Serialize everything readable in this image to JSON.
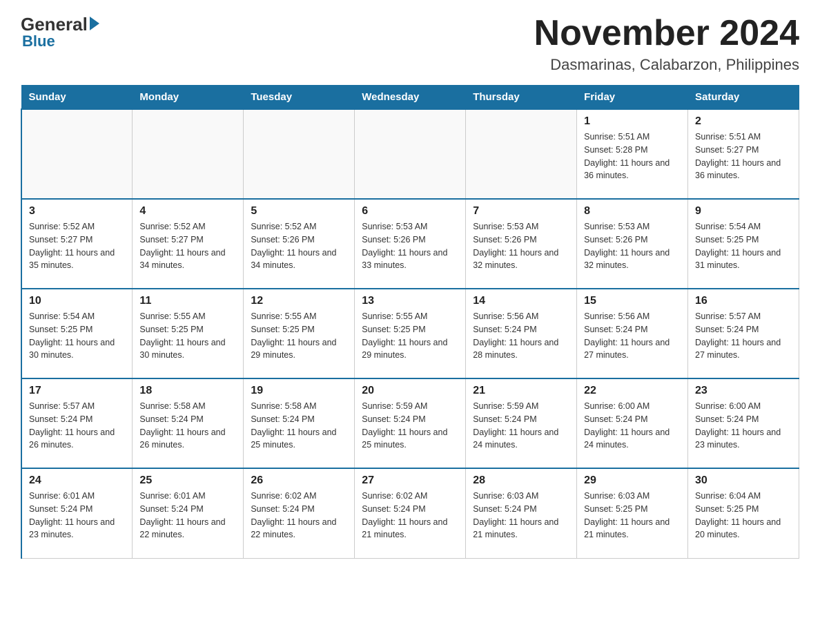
{
  "header": {
    "logo_main": "General",
    "logo_accent": "Blue",
    "month_title": "November 2024",
    "location": "Dasmarinas, Calabarzon, Philippines"
  },
  "days_of_week": [
    "Sunday",
    "Monday",
    "Tuesday",
    "Wednesday",
    "Thursday",
    "Friday",
    "Saturday"
  ],
  "weeks": [
    [
      {
        "day": "",
        "sunrise": "",
        "sunset": "",
        "daylight": ""
      },
      {
        "day": "",
        "sunrise": "",
        "sunset": "",
        "daylight": ""
      },
      {
        "day": "",
        "sunrise": "",
        "sunset": "",
        "daylight": ""
      },
      {
        "day": "",
        "sunrise": "",
        "sunset": "",
        "daylight": ""
      },
      {
        "day": "",
        "sunrise": "",
        "sunset": "",
        "daylight": ""
      },
      {
        "day": "1",
        "sunrise": "Sunrise: 5:51 AM",
        "sunset": "Sunset: 5:28 PM",
        "daylight": "Daylight: 11 hours and 36 minutes."
      },
      {
        "day": "2",
        "sunrise": "Sunrise: 5:51 AM",
        "sunset": "Sunset: 5:27 PM",
        "daylight": "Daylight: 11 hours and 36 minutes."
      }
    ],
    [
      {
        "day": "3",
        "sunrise": "Sunrise: 5:52 AM",
        "sunset": "Sunset: 5:27 PM",
        "daylight": "Daylight: 11 hours and 35 minutes."
      },
      {
        "day": "4",
        "sunrise": "Sunrise: 5:52 AM",
        "sunset": "Sunset: 5:27 PM",
        "daylight": "Daylight: 11 hours and 34 minutes."
      },
      {
        "day": "5",
        "sunrise": "Sunrise: 5:52 AM",
        "sunset": "Sunset: 5:26 PM",
        "daylight": "Daylight: 11 hours and 34 minutes."
      },
      {
        "day": "6",
        "sunrise": "Sunrise: 5:53 AM",
        "sunset": "Sunset: 5:26 PM",
        "daylight": "Daylight: 11 hours and 33 minutes."
      },
      {
        "day": "7",
        "sunrise": "Sunrise: 5:53 AM",
        "sunset": "Sunset: 5:26 PM",
        "daylight": "Daylight: 11 hours and 32 minutes."
      },
      {
        "day": "8",
        "sunrise": "Sunrise: 5:53 AM",
        "sunset": "Sunset: 5:26 PM",
        "daylight": "Daylight: 11 hours and 32 minutes."
      },
      {
        "day": "9",
        "sunrise": "Sunrise: 5:54 AM",
        "sunset": "Sunset: 5:25 PM",
        "daylight": "Daylight: 11 hours and 31 minutes."
      }
    ],
    [
      {
        "day": "10",
        "sunrise": "Sunrise: 5:54 AM",
        "sunset": "Sunset: 5:25 PM",
        "daylight": "Daylight: 11 hours and 30 minutes."
      },
      {
        "day": "11",
        "sunrise": "Sunrise: 5:55 AM",
        "sunset": "Sunset: 5:25 PM",
        "daylight": "Daylight: 11 hours and 30 minutes."
      },
      {
        "day": "12",
        "sunrise": "Sunrise: 5:55 AM",
        "sunset": "Sunset: 5:25 PM",
        "daylight": "Daylight: 11 hours and 29 minutes."
      },
      {
        "day": "13",
        "sunrise": "Sunrise: 5:55 AM",
        "sunset": "Sunset: 5:25 PM",
        "daylight": "Daylight: 11 hours and 29 minutes."
      },
      {
        "day": "14",
        "sunrise": "Sunrise: 5:56 AM",
        "sunset": "Sunset: 5:24 PM",
        "daylight": "Daylight: 11 hours and 28 minutes."
      },
      {
        "day": "15",
        "sunrise": "Sunrise: 5:56 AM",
        "sunset": "Sunset: 5:24 PM",
        "daylight": "Daylight: 11 hours and 27 minutes."
      },
      {
        "day": "16",
        "sunrise": "Sunrise: 5:57 AM",
        "sunset": "Sunset: 5:24 PM",
        "daylight": "Daylight: 11 hours and 27 minutes."
      }
    ],
    [
      {
        "day": "17",
        "sunrise": "Sunrise: 5:57 AM",
        "sunset": "Sunset: 5:24 PM",
        "daylight": "Daylight: 11 hours and 26 minutes."
      },
      {
        "day": "18",
        "sunrise": "Sunrise: 5:58 AM",
        "sunset": "Sunset: 5:24 PM",
        "daylight": "Daylight: 11 hours and 26 minutes."
      },
      {
        "day": "19",
        "sunrise": "Sunrise: 5:58 AM",
        "sunset": "Sunset: 5:24 PM",
        "daylight": "Daylight: 11 hours and 25 minutes."
      },
      {
        "day": "20",
        "sunrise": "Sunrise: 5:59 AM",
        "sunset": "Sunset: 5:24 PM",
        "daylight": "Daylight: 11 hours and 25 minutes."
      },
      {
        "day": "21",
        "sunrise": "Sunrise: 5:59 AM",
        "sunset": "Sunset: 5:24 PM",
        "daylight": "Daylight: 11 hours and 24 minutes."
      },
      {
        "day": "22",
        "sunrise": "Sunrise: 6:00 AM",
        "sunset": "Sunset: 5:24 PM",
        "daylight": "Daylight: 11 hours and 24 minutes."
      },
      {
        "day": "23",
        "sunrise": "Sunrise: 6:00 AM",
        "sunset": "Sunset: 5:24 PM",
        "daylight": "Daylight: 11 hours and 23 minutes."
      }
    ],
    [
      {
        "day": "24",
        "sunrise": "Sunrise: 6:01 AM",
        "sunset": "Sunset: 5:24 PM",
        "daylight": "Daylight: 11 hours and 23 minutes."
      },
      {
        "day": "25",
        "sunrise": "Sunrise: 6:01 AM",
        "sunset": "Sunset: 5:24 PM",
        "daylight": "Daylight: 11 hours and 22 minutes."
      },
      {
        "day": "26",
        "sunrise": "Sunrise: 6:02 AM",
        "sunset": "Sunset: 5:24 PM",
        "daylight": "Daylight: 11 hours and 22 minutes."
      },
      {
        "day": "27",
        "sunrise": "Sunrise: 6:02 AM",
        "sunset": "Sunset: 5:24 PM",
        "daylight": "Daylight: 11 hours and 21 minutes."
      },
      {
        "day": "28",
        "sunrise": "Sunrise: 6:03 AM",
        "sunset": "Sunset: 5:24 PM",
        "daylight": "Daylight: 11 hours and 21 minutes."
      },
      {
        "day": "29",
        "sunrise": "Sunrise: 6:03 AM",
        "sunset": "Sunset: 5:25 PM",
        "daylight": "Daylight: 11 hours and 21 minutes."
      },
      {
        "day": "30",
        "sunrise": "Sunrise: 6:04 AM",
        "sunset": "Sunset: 5:25 PM",
        "daylight": "Daylight: 11 hours and 20 minutes."
      }
    ]
  ]
}
